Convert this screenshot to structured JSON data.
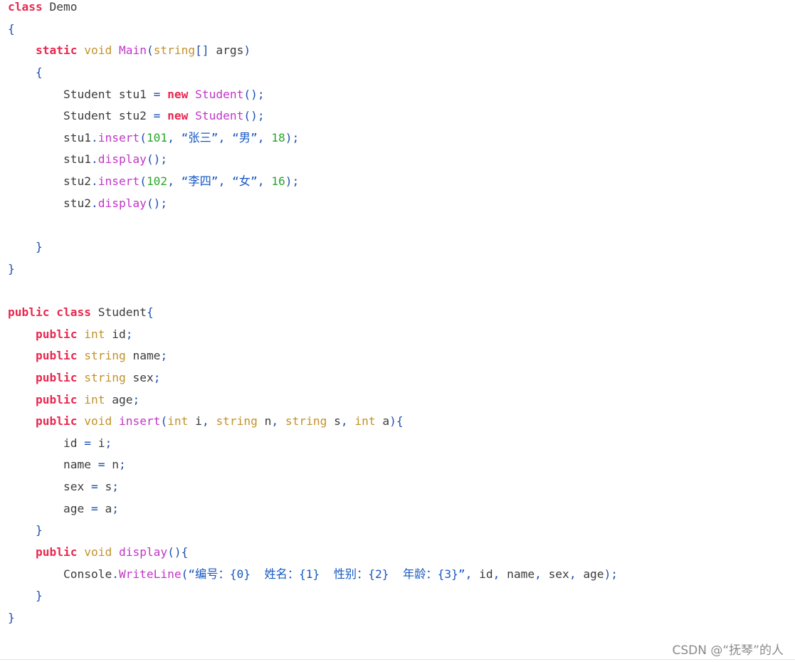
{
  "code_block": {
    "language": "csharp",
    "colors": {
      "keyword": "#e8284f",
      "type": "#c29228",
      "function": "#c235c9",
      "number": "#2aa52a",
      "string": "#1658c4",
      "punctuation": "#1f4fb0",
      "plain": "#3b3b3b"
    },
    "lines": [
      [
        {
          "t": "kw",
          "v": "class"
        },
        {
          "t": "plain",
          "v": " Demo"
        }
      ],
      [
        {
          "t": "punc",
          "v": "{"
        }
      ],
      [
        {
          "t": "plain",
          "v": "    "
        },
        {
          "t": "kw",
          "v": "static"
        },
        {
          "t": "plain",
          "v": " "
        },
        {
          "t": "type",
          "v": "void"
        },
        {
          "t": "plain",
          "v": " "
        },
        {
          "t": "fn",
          "v": "Main"
        },
        {
          "t": "punc",
          "v": "("
        },
        {
          "t": "type",
          "v": "string"
        },
        {
          "t": "punc",
          "v": "[]"
        },
        {
          "t": "plain",
          "v": " args"
        },
        {
          "t": "punc",
          "v": ")"
        }
      ],
      [
        {
          "t": "plain",
          "v": "    "
        },
        {
          "t": "punc",
          "v": "{"
        }
      ],
      [
        {
          "t": "plain",
          "v": "        Student stu1 "
        },
        {
          "t": "punc",
          "v": "="
        },
        {
          "t": "plain",
          "v": " "
        },
        {
          "t": "kw",
          "v": "new"
        },
        {
          "t": "plain",
          "v": " "
        },
        {
          "t": "fn",
          "v": "Student"
        },
        {
          "t": "punc",
          "v": "();"
        }
      ],
      [
        {
          "t": "plain",
          "v": "        Student stu2 "
        },
        {
          "t": "punc",
          "v": "="
        },
        {
          "t": "plain",
          "v": " "
        },
        {
          "t": "kw",
          "v": "new"
        },
        {
          "t": "plain",
          "v": " "
        },
        {
          "t": "fn",
          "v": "Student"
        },
        {
          "t": "punc",
          "v": "();"
        }
      ],
      [
        {
          "t": "plain",
          "v": "        stu1"
        },
        {
          "t": "punc",
          "v": "."
        },
        {
          "t": "fn",
          "v": "insert"
        },
        {
          "t": "punc",
          "v": "("
        },
        {
          "t": "num",
          "v": "101"
        },
        {
          "t": "punc",
          "v": ", "
        },
        {
          "t": "str",
          "v": "“张三”"
        },
        {
          "t": "punc",
          "v": ", "
        },
        {
          "t": "str",
          "v": "“男”"
        },
        {
          "t": "punc",
          "v": ", "
        },
        {
          "t": "num",
          "v": "18"
        },
        {
          "t": "punc",
          "v": ");"
        }
      ],
      [
        {
          "t": "plain",
          "v": "        stu1"
        },
        {
          "t": "punc",
          "v": "."
        },
        {
          "t": "fn",
          "v": "display"
        },
        {
          "t": "punc",
          "v": "();"
        }
      ],
      [
        {
          "t": "plain",
          "v": "        stu2"
        },
        {
          "t": "punc",
          "v": "."
        },
        {
          "t": "fn",
          "v": "insert"
        },
        {
          "t": "punc",
          "v": "("
        },
        {
          "t": "num",
          "v": "102"
        },
        {
          "t": "punc",
          "v": ", "
        },
        {
          "t": "str",
          "v": "“李四”"
        },
        {
          "t": "punc",
          "v": ", "
        },
        {
          "t": "str",
          "v": "“女”"
        },
        {
          "t": "punc",
          "v": ", "
        },
        {
          "t": "num",
          "v": "16"
        },
        {
          "t": "punc",
          "v": ");"
        }
      ],
      [
        {
          "t": "plain",
          "v": "        stu2"
        },
        {
          "t": "punc",
          "v": "."
        },
        {
          "t": "fn",
          "v": "display"
        },
        {
          "t": "punc",
          "v": "();"
        }
      ],
      [],
      [
        {
          "t": "plain",
          "v": "    "
        },
        {
          "t": "punc",
          "v": "}"
        }
      ],
      [
        {
          "t": "punc",
          "v": "}"
        }
      ],
      [],
      [
        {
          "t": "kw",
          "v": "public"
        },
        {
          "t": "plain",
          "v": " "
        },
        {
          "t": "kw",
          "v": "class"
        },
        {
          "t": "plain",
          "v": " Student"
        },
        {
          "t": "punc",
          "v": "{"
        }
      ],
      [
        {
          "t": "plain",
          "v": "    "
        },
        {
          "t": "kw",
          "v": "public"
        },
        {
          "t": "plain",
          "v": " "
        },
        {
          "t": "type",
          "v": "int"
        },
        {
          "t": "plain",
          "v": " id"
        },
        {
          "t": "punc",
          "v": ";"
        }
      ],
      [
        {
          "t": "plain",
          "v": "    "
        },
        {
          "t": "kw",
          "v": "public"
        },
        {
          "t": "plain",
          "v": " "
        },
        {
          "t": "type",
          "v": "string"
        },
        {
          "t": "plain",
          "v": " name"
        },
        {
          "t": "punc",
          "v": ";"
        }
      ],
      [
        {
          "t": "plain",
          "v": "    "
        },
        {
          "t": "kw",
          "v": "public"
        },
        {
          "t": "plain",
          "v": " "
        },
        {
          "t": "type",
          "v": "string"
        },
        {
          "t": "plain",
          "v": " sex"
        },
        {
          "t": "punc",
          "v": ";"
        }
      ],
      [
        {
          "t": "plain",
          "v": "    "
        },
        {
          "t": "kw",
          "v": "public"
        },
        {
          "t": "plain",
          "v": " "
        },
        {
          "t": "type",
          "v": "int"
        },
        {
          "t": "plain",
          "v": " age"
        },
        {
          "t": "punc",
          "v": ";"
        }
      ],
      [
        {
          "t": "plain",
          "v": "    "
        },
        {
          "t": "kw",
          "v": "public"
        },
        {
          "t": "plain",
          "v": " "
        },
        {
          "t": "type",
          "v": "void"
        },
        {
          "t": "plain",
          "v": " "
        },
        {
          "t": "fn",
          "v": "insert"
        },
        {
          "t": "punc",
          "v": "("
        },
        {
          "t": "type",
          "v": "int"
        },
        {
          "t": "plain",
          "v": " i"
        },
        {
          "t": "punc",
          "v": ", "
        },
        {
          "t": "type",
          "v": "string"
        },
        {
          "t": "plain",
          "v": " n"
        },
        {
          "t": "punc",
          "v": ", "
        },
        {
          "t": "type",
          "v": "string"
        },
        {
          "t": "plain",
          "v": " s"
        },
        {
          "t": "punc",
          "v": ", "
        },
        {
          "t": "type",
          "v": "int"
        },
        {
          "t": "plain",
          "v": " a"
        },
        {
          "t": "punc",
          "v": "){"
        }
      ],
      [
        {
          "t": "plain",
          "v": "        id "
        },
        {
          "t": "punc",
          "v": "="
        },
        {
          "t": "plain",
          "v": " i"
        },
        {
          "t": "punc",
          "v": ";"
        }
      ],
      [
        {
          "t": "plain",
          "v": "        name "
        },
        {
          "t": "punc",
          "v": "="
        },
        {
          "t": "plain",
          "v": " n"
        },
        {
          "t": "punc",
          "v": ";"
        }
      ],
      [
        {
          "t": "plain",
          "v": "        sex "
        },
        {
          "t": "punc",
          "v": "="
        },
        {
          "t": "plain",
          "v": " s"
        },
        {
          "t": "punc",
          "v": ";"
        }
      ],
      [
        {
          "t": "plain",
          "v": "        age "
        },
        {
          "t": "punc",
          "v": "="
        },
        {
          "t": "plain",
          "v": " a"
        },
        {
          "t": "punc",
          "v": ";"
        }
      ],
      [
        {
          "t": "plain",
          "v": "    "
        },
        {
          "t": "punc",
          "v": "}"
        }
      ],
      [
        {
          "t": "plain",
          "v": "    "
        },
        {
          "t": "kw",
          "v": "public"
        },
        {
          "t": "plain",
          "v": " "
        },
        {
          "t": "type",
          "v": "void"
        },
        {
          "t": "plain",
          "v": " "
        },
        {
          "t": "fn",
          "v": "display"
        },
        {
          "t": "punc",
          "v": "(){"
        }
      ],
      [
        {
          "t": "plain",
          "v": "        Console"
        },
        {
          "t": "punc",
          "v": "."
        },
        {
          "t": "fn",
          "v": "WriteLine"
        },
        {
          "t": "punc",
          "v": "("
        },
        {
          "t": "str",
          "v": "“编号：{0}  姓名：{1}  性别：{2}  年龄：{3}”"
        },
        {
          "t": "punc",
          "v": ", "
        },
        {
          "t": "plain",
          "v": "id"
        },
        {
          "t": "punc",
          "v": ", "
        },
        {
          "t": "plain",
          "v": "name"
        },
        {
          "t": "punc",
          "v": ", "
        },
        {
          "t": "plain",
          "v": "sex"
        },
        {
          "t": "punc",
          "v": ", "
        },
        {
          "t": "plain",
          "v": "age"
        },
        {
          "t": "punc",
          "v": ");"
        }
      ],
      [
        {
          "t": "plain",
          "v": "    "
        },
        {
          "t": "punc",
          "v": "}"
        }
      ],
      [
        {
          "t": "punc",
          "v": "}"
        }
      ]
    ]
  },
  "watermark": "CSDN @“抚琴”的人"
}
